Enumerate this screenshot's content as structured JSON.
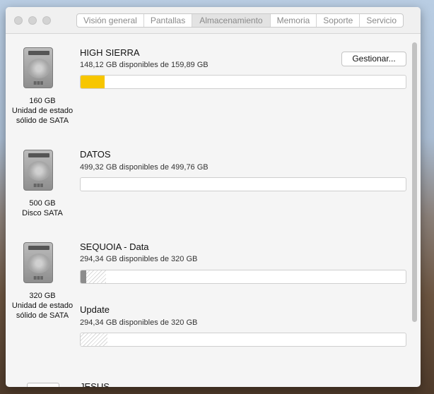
{
  "tabs": [
    "Visión general",
    "Pantallas",
    "Almacenamiento",
    "Memoria",
    "Soporte",
    "Servicio"
  ],
  "selected_tab": "Almacenamiento",
  "manage_button": "Gestionar...",
  "disks": [
    {
      "capacity": "160 GB",
      "type_line1": "Unidad de estado",
      "type_line2": "sólido de SATA",
      "volumes": [
        {
          "name": "HIGH SIERRA",
          "info": "148,12 GB disponibles de 159,89 GB",
          "used_percent": 7.4,
          "color": "#f7c600"
        }
      ]
    },
    {
      "capacity": "500 GB",
      "type_line1": "Disco SATA",
      "type_line2": "",
      "volumes": [
        {
          "name": "DATOS",
          "info": "499,32 GB disponibles de 499,76 GB",
          "used_percent": 0.1
        }
      ]
    },
    {
      "capacity": "320 GB",
      "type_line1": "Unidad de estado",
      "type_line2": "sólido de SATA",
      "volumes": [
        {
          "name": "SEQUOIA - Data",
          "info": "294,34 GB disponibles de 320 GB",
          "used_percent": 2,
          "other_percent": 6,
          "color": "#8c8c8c"
        },
        {
          "name": "Update",
          "info": "294,34 GB disponibles de 320 GB",
          "used_percent": 0,
          "other_percent": 8
        }
      ]
    },
    {
      "volumes": [
        {
          "name": "JESUS"
        }
      ]
    }
  ]
}
